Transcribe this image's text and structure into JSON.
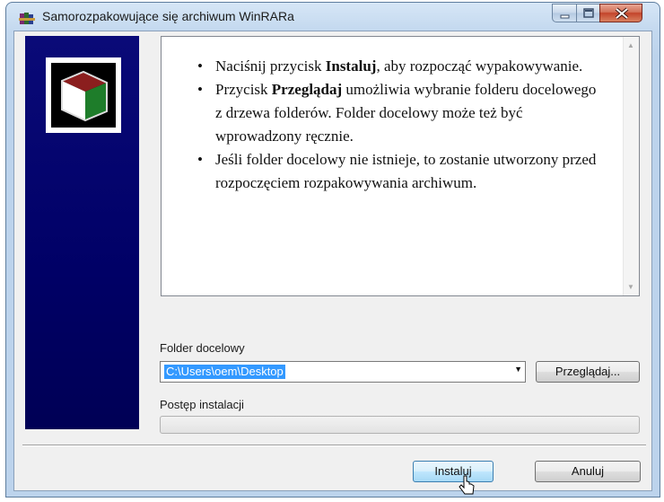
{
  "window": {
    "title": "Samorozpakowujące się archiwum WinRARa",
    "icon": "winrar-books-icon",
    "controls": {
      "minimize": "minimize-icon",
      "maximize": "maximize-icon",
      "close": "close-icon"
    }
  },
  "banner": {
    "logo": "winrar-box-logo",
    "color": "#000066"
  },
  "info": {
    "items": [
      {
        "before": "Naciśnij przycisk ",
        "bold": "Instaluj",
        "after": ", aby rozpocząć wypakowywanie."
      },
      {
        "before": "Przycisk ",
        "bold": "Przeglądaj",
        "after": " umożliwia wybranie folderu docelowego z drzewa folderów. Folder docelowy może też być wprowadzony ręcznie."
      },
      {
        "before": "Jeśli folder docelowy nie istnieje, to zostanie utworzony przed rozpoczęciem rozpakowywania archiwum.",
        "bold": "",
        "after": ""
      }
    ]
  },
  "destination": {
    "label": "Folder docelowy",
    "value": "C:\\Users\\oem\\Desktop",
    "browse_label": "Przeglądaj..."
  },
  "progress": {
    "label": "Postęp instalacji",
    "fraction": 0.0
  },
  "buttons": {
    "install": "Instaluj",
    "cancel": "Anuluj"
  },
  "colors": {
    "selection": "#3399ff",
    "close_button": "#c3442a",
    "default_button_border": "#3c7fb1"
  }
}
